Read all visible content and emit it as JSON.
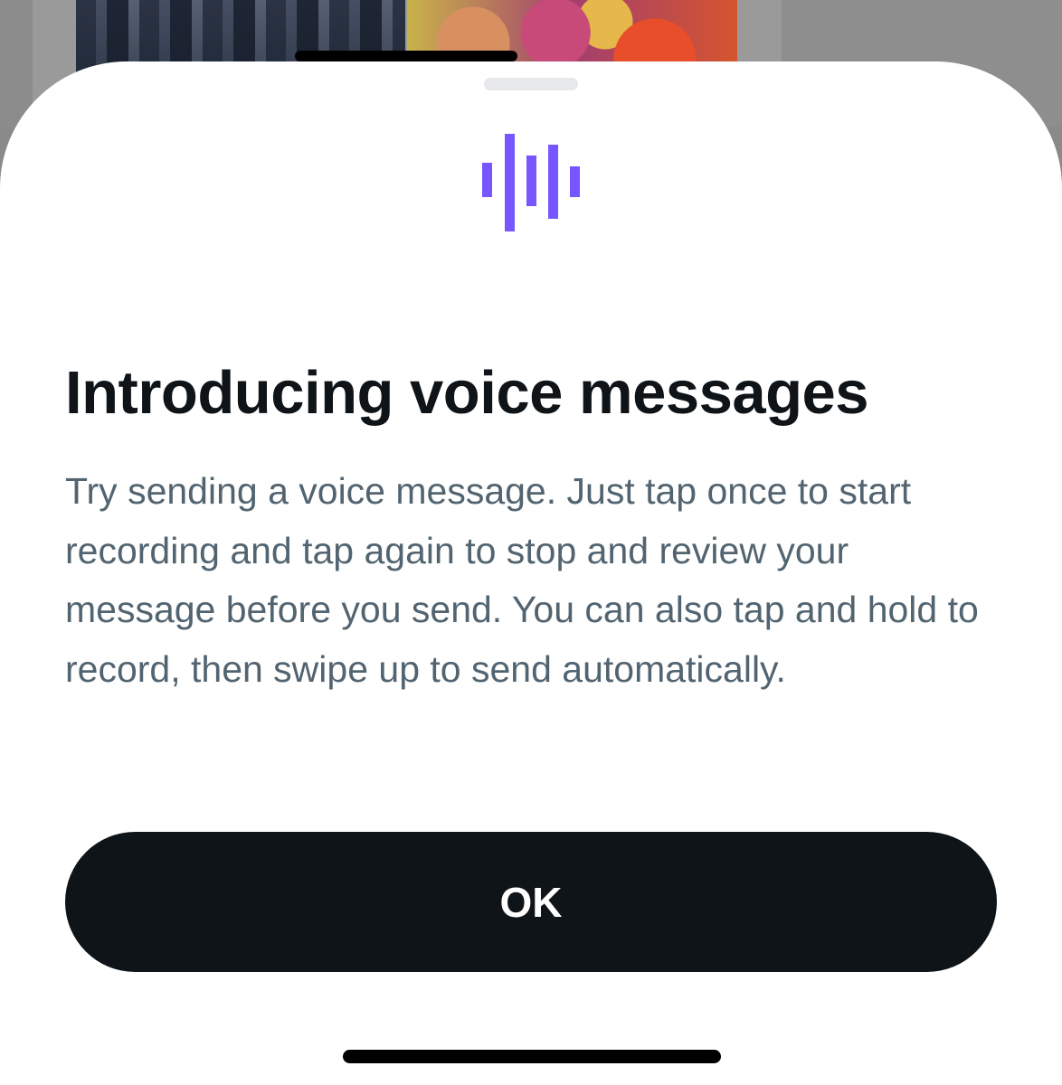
{
  "sheet": {
    "icon": "voice-waveform-icon",
    "accent_color": "#7856ff",
    "title": "Introducing voice messages",
    "description": "Try sending a voice message. Just tap once to start recording and tap again to stop and review your message before you send. You can also tap and hold to record, then swipe up to send automatically.",
    "ok_label": "OK"
  },
  "colors": {
    "title": "#0f1419",
    "description": "#536471",
    "button_bg": "#0f1419",
    "button_text": "#ffffff"
  }
}
